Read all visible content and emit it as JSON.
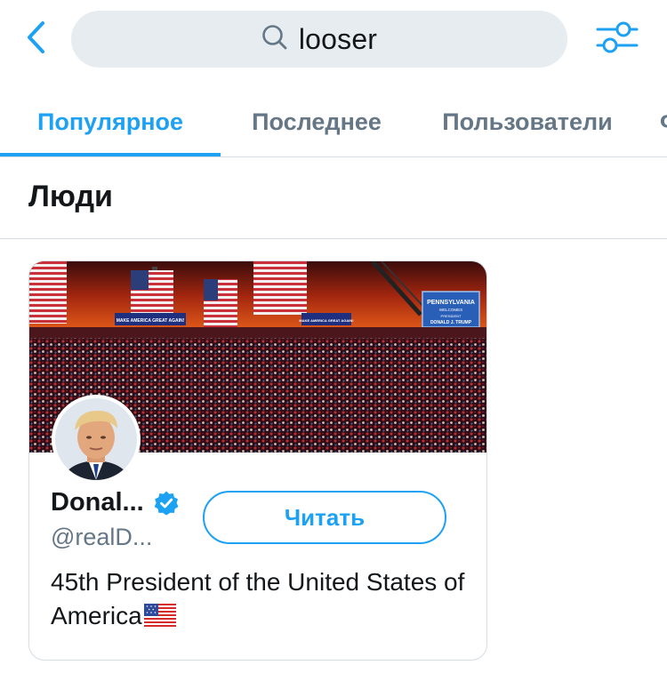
{
  "search": {
    "query": "looser"
  },
  "icons": {
    "back": "chevron-left-icon",
    "search": "search-icon",
    "filter": "sliders-icon",
    "verified": "verified-badge-icon",
    "flag": "us-flag-icon"
  },
  "tabs": [
    {
      "label": "Популярное",
      "active": true
    },
    {
      "label": "Последнее",
      "active": false
    },
    {
      "label": "Пользователи",
      "active": false
    },
    {
      "label": "Фото",
      "active": false
    }
  ],
  "section": {
    "title": "Люди"
  },
  "user_card": {
    "display_name": "Donal...",
    "handle": "@realD...",
    "follow_label": "Читать",
    "bio": "45th President of the United States of America",
    "verified": true,
    "banner_text": {
      "sign_main": "PENNSYLVANIA",
      "sign_line2": "WELCOMES",
      "sign_line3": "PRESIDENT",
      "sign_line4": "DONALD J. TRUMP",
      "banner_small_1": "MAKE AMERICA GREAT AGAIN!",
      "banner_small_2": "MAKE AMERICA GREAT AGAIN!"
    }
  },
  "colors": {
    "accent": "#1da1f2",
    "text_primary": "#14171a",
    "text_secondary": "#657786",
    "search_bg": "#e6ecf0",
    "divider": "#d7dde2"
  }
}
